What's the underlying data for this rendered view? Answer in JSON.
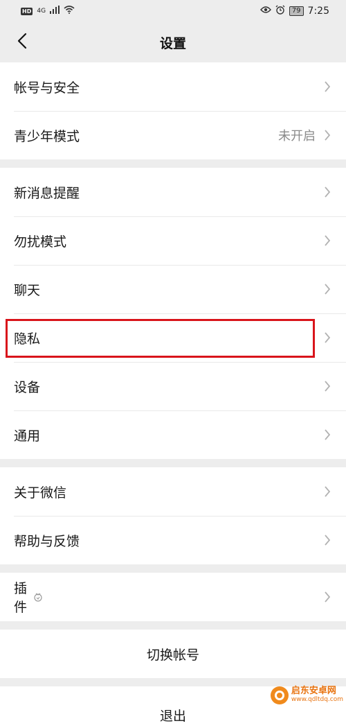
{
  "status_bar": {
    "hd": "HD",
    "network": "4G",
    "battery": "79",
    "time": "7:25"
  },
  "nav": {
    "title": "设置"
  },
  "groups": [
    [
      {
        "label": "帐号与安全",
        "value": ""
      },
      {
        "label": "青少年模式",
        "value": "未开启"
      }
    ],
    [
      {
        "label": "新消息提醒",
        "value": ""
      },
      {
        "label": "勿扰模式",
        "value": ""
      },
      {
        "label": "聊天",
        "value": ""
      },
      {
        "label": "隐私",
        "value": ""
      },
      {
        "label": "设备",
        "value": ""
      },
      {
        "label": "通用",
        "value": ""
      }
    ],
    [
      {
        "label": "关于微信",
        "value": ""
      },
      {
        "label": "帮助与反馈",
        "value": ""
      }
    ],
    [
      {
        "label": "插件",
        "value": ""
      }
    ]
  ],
  "actions": {
    "switch_account": "切换帐号",
    "logout": "退出"
  },
  "highlight_color": "#d9141b",
  "watermark": {
    "name": "启东安卓网",
    "url": "www.qdltdq.com"
  }
}
